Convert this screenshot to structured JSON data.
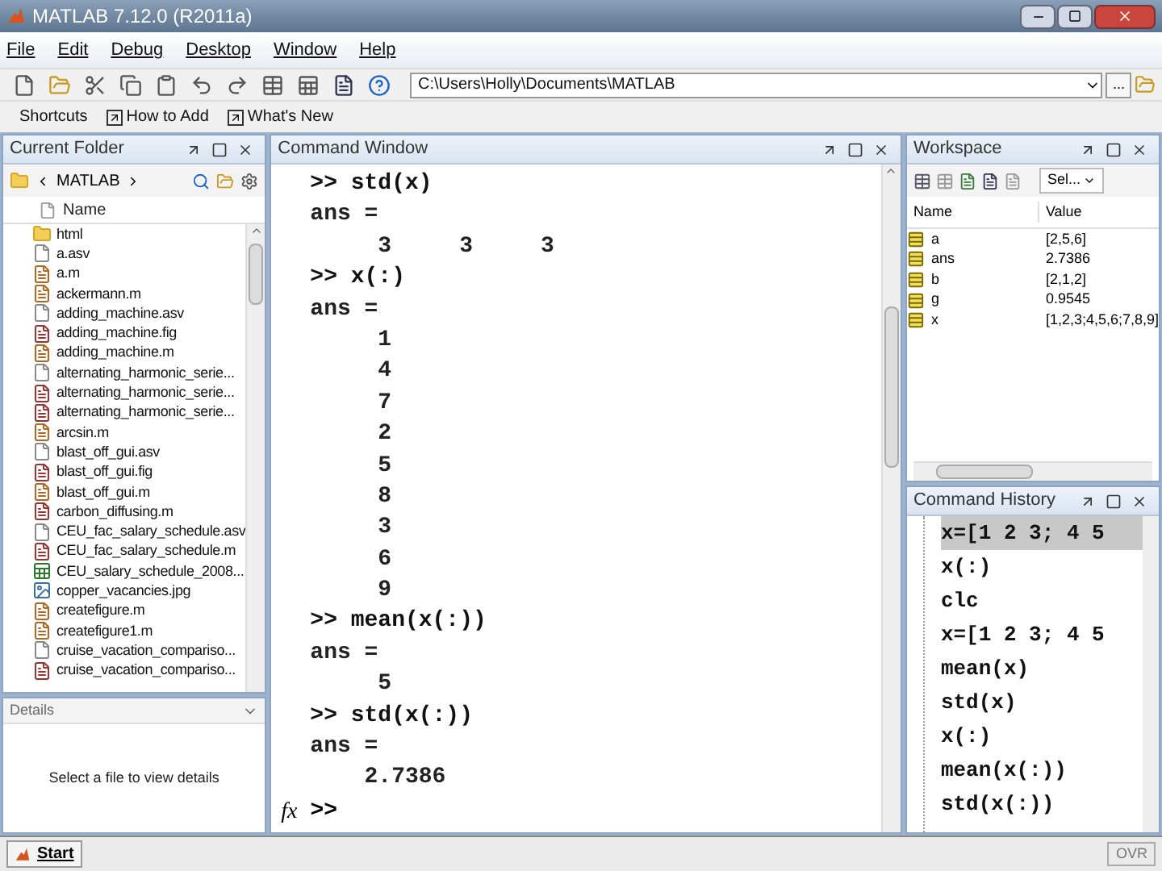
{
  "window": {
    "title": "MATLAB  7.12.0 (R2011a)"
  },
  "menu": [
    "File",
    "Edit",
    "Debug",
    "Desktop",
    "Window",
    "Help"
  ],
  "toolbar": {
    "path": "C:\\Users\\Holly\\Documents\\MATLAB",
    "browse": "..."
  },
  "shortcuts": [
    "Shortcuts",
    "How to Add",
    "What's New"
  ],
  "current_folder": {
    "title": "Current Folder",
    "breadcrumb": "MATLAB",
    "column": "Name",
    "files": [
      {
        "name": "html",
        "kind": "folder"
      },
      {
        "name": "a.asv",
        "kind": "plain"
      },
      {
        "name": "a.m",
        "kind": "script"
      },
      {
        "name": "ackermann.m",
        "kind": "script"
      },
      {
        "name": "adding_machine.asv",
        "kind": "plain"
      },
      {
        "name": "adding_machine.fig",
        "kind": "figure"
      },
      {
        "name": "adding_machine.m",
        "kind": "script"
      },
      {
        "name": "alternating_harmonic_serie...",
        "kind": "plain"
      },
      {
        "name": "alternating_harmonic_serie...",
        "kind": "figure"
      },
      {
        "name": "alternating_harmonic_serie...",
        "kind": "figure"
      },
      {
        "name": "arcsin.m",
        "kind": "script"
      },
      {
        "name": "blast_off_gui.asv",
        "kind": "plain"
      },
      {
        "name": "blast_off_gui.fig",
        "kind": "figure"
      },
      {
        "name": "blast_off_gui.m",
        "kind": "script"
      },
      {
        "name": "carbon_diffusing.m",
        "kind": "figure"
      },
      {
        "name": "CEU_fac_salary_schedule.asv",
        "kind": "plain"
      },
      {
        "name": "CEU_fac_salary_schedule.m",
        "kind": "figure"
      },
      {
        "name": "CEU_salary_schedule_2008...",
        "kind": "sheet"
      },
      {
        "name": "copper_vacancies.jpg",
        "kind": "image"
      },
      {
        "name": "createfigure.m",
        "kind": "script"
      },
      {
        "name": "createfigure1.m",
        "kind": "script"
      },
      {
        "name": "cruise_vacation_compariso...",
        "kind": "plain"
      },
      {
        "name": "cruise_vacation_compariso...",
        "kind": "figure"
      }
    ]
  },
  "details": {
    "title": "Details",
    "message": "Select a file to view details"
  },
  "command_window": {
    "title": "Command Window",
    "prompt": ">>",
    "function_label": "fx",
    "lines": [
      {
        "text": ">> std(x)",
        "kind": "input"
      },
      {
        "text": "ans =",
        "kind": "output"
      },
      {
        "text": "     3     3     3",
        "kind": "output"
      },
      {
        "text": ">> x(:)",
        "kind": "input"
      },
      {
        "text": "ans =",
        "kind": "output"
      },
      {
        "text": "     1",
        "kind": "output"
      },
      {
        "text": "     4",
        "kind": "output"
      },
      {
        "text": "     7",
        "kind": "output"
      },
      {
        "text": "     2",
        "kind": "output"
      },
      {
        "text": "     5",
        "kind": "output"
      },
      {
        "text": "     8",
        "kind": "output"
      },
      {
        "text": "     3",
        "kind": "output"
      },
      {
        "text": "     6",
        "kind": "output"
      },
      {
        "text": "     9",
        "kind": "output"
      },
      {
        "text": ">> mean(x(:))",
        "kind": "input"
      },
      {
        "text": "ans =",
        "kind": "output"
      },
      {
        "text": "     5",
        "kind": "output"
      },
      {
        "text": ">> std(x(:))",
        "kind": "input"
      },
      {
        "text": "ans =",
        "kind": "output"
      },
      {
        "text": "    2.7386",
        "kind": "output"
      }
    ]
  },
  "workspace": {
    "title": "Workspace",
    "select": "Sel...",
    "columns": [
      "Name",
      "Value"
    ],
    "variables": [
      {
        "name": "a",
        "value": "[2,5,6]"
      },
      {
        "name": "ans",
        "value": "2.7386"
      },
      {
        "name": "b",
        "value": "[2,1,2]"
      },
      {
        "name": "g",
        "value": "0.9545"
      },
      {
        "name": "x",
        "value": "[1,2,3;4,5,6;7,8,9]"
      }
    ]
  },
  "history": {
    "title": "Command History",
    "entries": [
      {
        "text": "x=[1 2 3; 4 5",
        "selected": true
      },
      {
        "text": "x(:)",
        "selected": false
      },
      {
        "text": "clc",
        "selected": false
      },
      {
        "text": "x=[1 2 3; 4 5",
        "selected": false
      },
      {
        "text": "mean(x)",
        "selected": false
      },
      {
        "text": "std(x)",
        "selected": false
      },
      {
        "text": "x(:)",
        "selected": false
      },
      {
        "text": "mean(x(:))",
        "selected": false
      },
      {
        "text": "std(x(:))",
        "selected": false
      }
    ]
  },
  "status_bar": {
    "start": "Start",
    "mode": "OVR"
  }
}
